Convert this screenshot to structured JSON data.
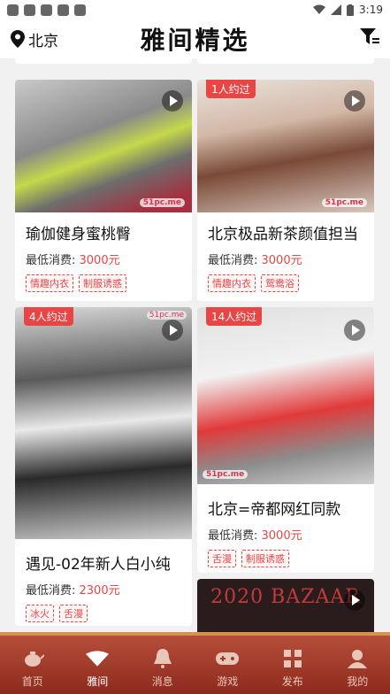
{
  "status_bar": {
    "time": "3:19"
  },
  "header": {
    "location": "北京",
    "title": "雅间精选"
  },
  "cards": [
    {
      "title": "瑜伽健身蜜桃臀",
      "price_label": "最低消费: ",
      "price": "3000元",
      "badge": "",
      "watermark": "51pc.me",
      "tags": [
        "情趣内衣",
        "制服诱惑"
      ]
    },
    {
      "title": "北京极品新茶颜值担当",
      "price_label": "最低消费: ",
      "price": "3000元",
      "badge": "1人约过",
      "watermark": "51pc.me",
      "tags": [
        "情趣内衣",
        "鸳鸯浴"
      ]
    },
    {
      "title": "遇见-02年新人白小纯",
      "price_label": "最低消费: ",
      "price": "2300元",
      "badge": "4人约过",
      "watermark": "51pc.me",
      "tags": [
        "冰火",
        "舌漫"
      ]
    },
    {
      "title": "北京=帝都网红同款",
      "price_label": "最低消费: ",
      "price": "3000元",
      "badge": "14人约过",
      "watermark": "51pc.me",
      "tags": [
        "舌漫",
        "制服诱惑"
      ]
    }
  ],
  "last_card": {
    "banner_text": "2020 BAZAAR"
  },
  "tabs": [
    {
      "label": "首页",
      "icon": "teapot-icon"
    },
    {
      "label": "雅间",
      "icon": "fan-icon"
    },
    {
      "label": "消息",
      "icon": "bell-icon"
    },
    {
      "label": "游戏",
      "icon": "gamepad-icon"
    },
    {
      "label": "发布",
      "icon": "grid-icon"
    },
    {
      "label": "我的",
      "icon": "person-icon"
    }
  ],
  "colors": {
    "accent": "#e84545",
    "tabbar": "#a23b2b"
  }
}
